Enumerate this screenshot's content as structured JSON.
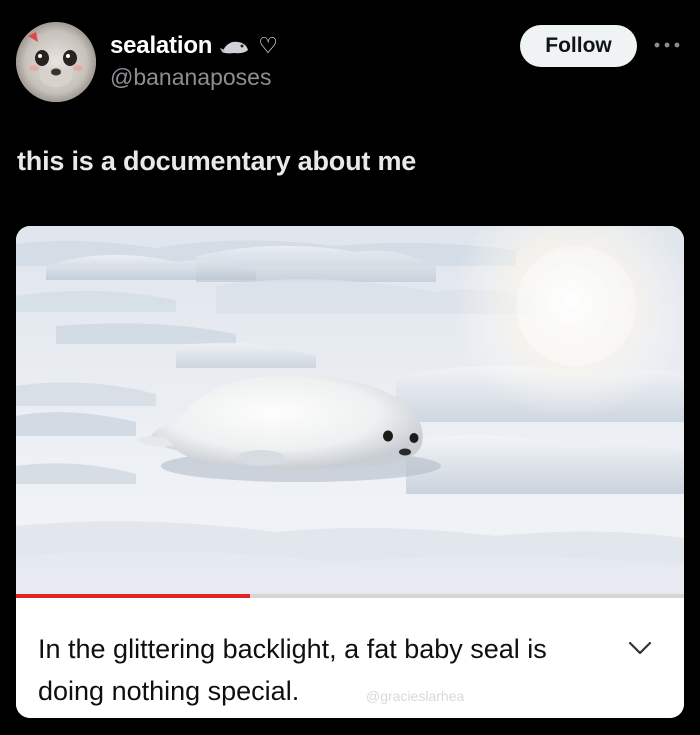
{
  "author": {
    "display_name": "sealation",
    "handle": "@bananaposes",
    "name_emoji": "seal-emoji",
    "name_heart": "♡"
  },
  "actions": {
    "follow_label": "Follow",
    "more_icon": "more-dots-icon"
  },
  "post": {
    "text": "this is a documentary about me"
  },
  "media": {
    "description_icon": "seal-on-snow-image",
    "caption": "In the glittering backlight, a fat baby seal is doing nothing special.",
    "watermark": "@gracieslarhea",
    "progress_fraction": 0.35,
    "progress_color": "#e0242a",
    "expand_icon": "chevron-down-icon"
  },
  "colors": {
    "background": "#000000",
    "follow_bg": "#eff3f4",
    "handle": "#8b8f94"
  }
}
